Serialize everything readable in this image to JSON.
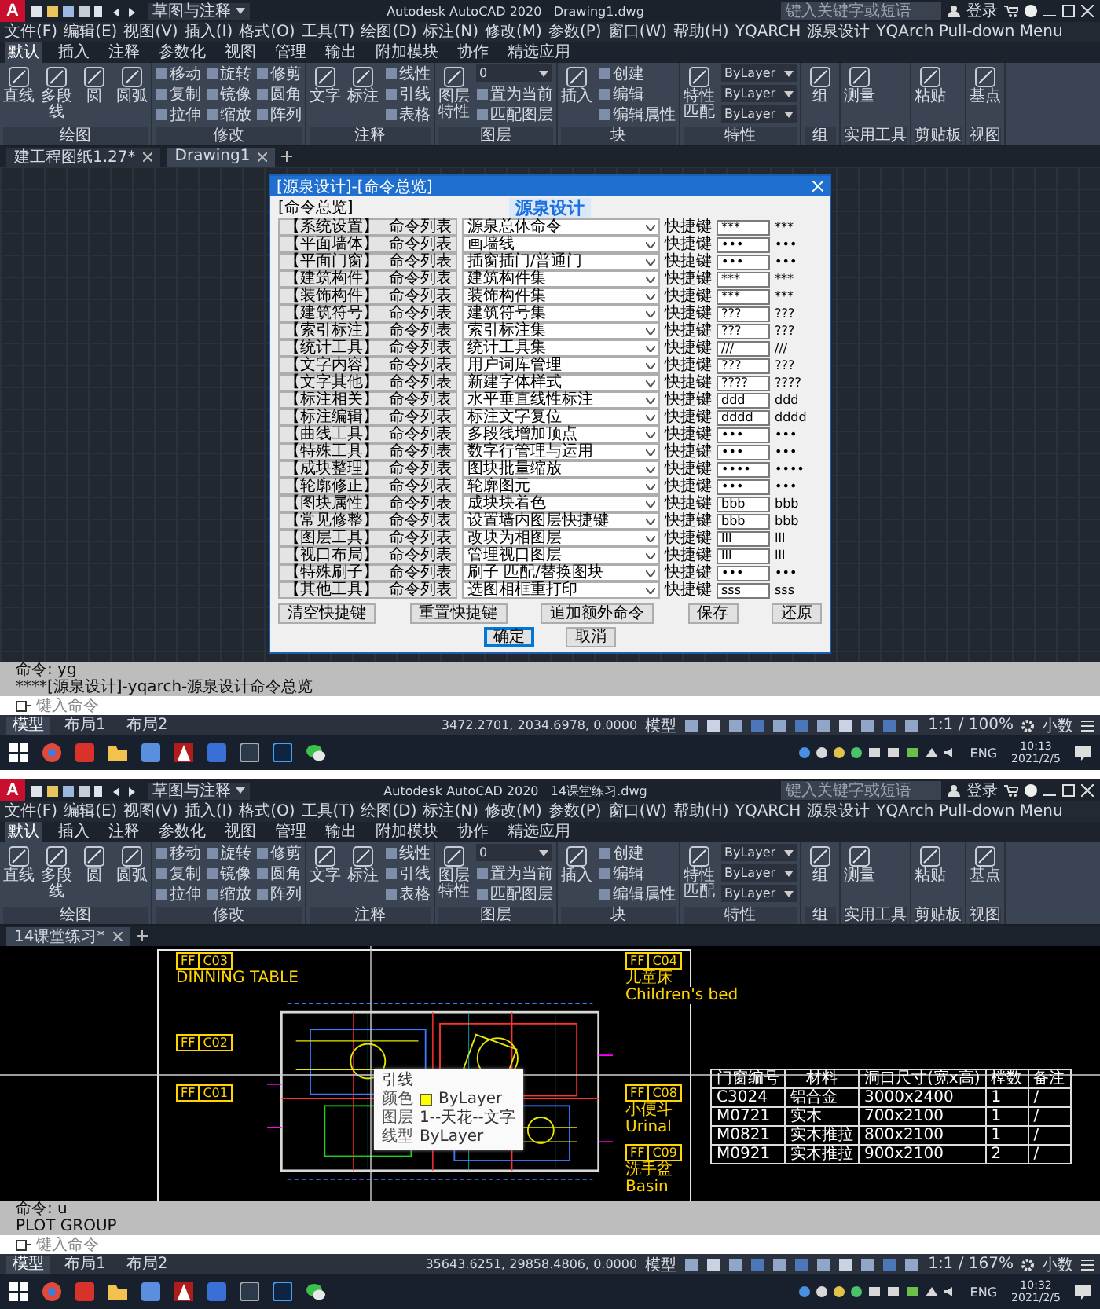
{
  "windows": [
    {
      "kind": "dialog",
      "app_logo": "A",
      "workspace": "草图与注释",
      "app_title": "Autodesk AutoCAD 2020",
      "file_title": "Drawing1.dwg",
      "search_placeholder": "键入关键字或短语",
      "user": "登录",
      "menu": [
        "文件(F)",
        "编辑(E)",
        "视图(V)",
        "插入(I)",
        "格式(O)",
        "工具(T)",
        "绘图(D)",
        "标注(N)",
        "修改(M)",
        "参数(P)",
        "窗口(W)",
        "帮助(H)",
        "YQARCH",
        "源泉设计",
        "YQArch Pull-down Menu"
      ],
      "ribbon_tabs": [
        {
          "label": "默认",
          "selected": true
        },
        {
          "label": "插入",
          "selected": false
        },
        {
          "label": "注释",
          "selected": false
        },
        {
          "label": "参数化",
          "selected": false
        },
        {
          "label": "视图",
          "selected": false
        },
        {
          "label": "管理",
          "selected": false
        },
        {
          "label": "输出",
          "selected": false
        },
        {
          "label": "附加模块",
          "selected": false
        },
        {
          "label": "协作",
          "selected": false
        },
        {
          "label": "精选应用",
          "selected": false
        }
      ],
      "ribbon": [
        {
          "title": "绘图",
          "items": [
            {
              "kind": "big",
              "label": "直线"
            },
            {
              "kind": "big",
              "label": "多段线"
            },
            {
              "kind": "big",
              "label": "圆"
            },
            {
              "kind": "big",
              "label": "圆弧"
            }
          ]
        },
        {
          "title": "修改",
          "items": [
            {
              "kind": "small",
              "label": "移动"
            },
            {
              "kind": "small",
              "label": "复制"
            },
            {
              "kind": "small",
              "label": "拉伸"
            },
            {
              "kind": "small",
              "label": "旋转"
            },
            {
              "kind": "small",
              "label": "镜像"
            },
            {
              "kind": "small",
              "label": "缩放"
            },
            {
              "kind": "small",
              "label": "修剪"
            },
            {
              "kind": "small",
              "label": "圆角"
            },
            {
              "kind": "small",
              "label": "阵列"
            }
          ]
        },
        {
          "title": "注释",
          "items": [
            {
              "kind": "big",
              "label": "文字"
            },
            {
              "kind": "big",
              "label": "标注"
            },
            {
              "kind": "small",
              "label": "线性"
            },
            {
              "kind": "small",
              "label": "引线"
            },
            {
              "kind": "small",
              "label": "表格"
            }
          ]
        },
        {
          "title": "图层",
          "items": [
            {
              "kind": "big",
              "label": "图层特性"
            },
            {
              "kind": "select",
              "label": "0"
            },
            {
              "kind": "small",
              "label": "置为当前"
            },
            {
              "kind": "small",
              "label": "匹配图层"
            }
          ]
        },
        {
          "title": "块",
          "items": [
            {
              "kind": "big",
              "label": "插入"
            },
            {
              "kind": "small",
              "label": "创建"
            },
            {
              "kind": "small",
              "label": "编辑"
            },
            {
              "kind": "small",
              "label": "编辑属性"
            }
          ]
        },
        {
          "title": "特性",
          "items": [
            {
              "kind": "big",
              "label": "特性匹配"
            },
            {
              "kind": "select",
              "label": "ByLayer"
            },
            {
              "kind": "select",
              "label": "ByLayer"
            },
            {
              "kind": "select",
              "label": "ByLayer"
            }
          ]
        },
        {
          "title": "组",
          "items": [
            {
              "kind": "big",
              "label": "组"
            }
          ]
        },
        {
          "title": "实用工具",
          "items": [
            {
              "kind": "big",
              "label": "测量"
            }
          ]
        },
        {
          "title": "剪贴板",
          "items": [
            {
              "kind": "big",
              "label": "粘贴"
            }
          ]
        },
        {
          "title": "视图",
          "items": [
            {
              "kind": "big",
              "label": "基点"
            }
          ]
        }
      ],
      "doc_tabs": [
        {
          "label": "建工程图纸1.27*",
          "selected": false
        },
        {
          "label": "Drawing1",
          "selected": true
        }
      ],
      "dialog": {
        "title": "[源泉设计]-[命令总览]",
        "logo": "源泉设计",
        "group": "[命令总览]",
        "rows": [
          {
            "category": "【系统设置】",
            "list": "命令列表",
            "command": "源泉总体命令",
            "shortcut_label": "快捷键",
            "shortcut": "***",
            "preview": "***"
          },
          {
            "category": "【平面墙体】",
            "list": "命令列表",
            "command": "画墙线",
            "shortcut_label": "快捷键",
            "shortcut": "•••",
            "preview": "•••"
          },
          {
            "category": "【平面门窗】",
            "list": "命令列表",
            "command": "插窗插门/普通门",
            "shortcut_label": "快捷键",
            "shortcut": "•••",
            "preview": "•••"
          },
          {
            "category": "【建筑构件】",
            "list": "命令列表",
            "command": "建筑构件集",
            "shortcut_label": "快捷键",
            "shortcut": "***",
            "preview": "***"
          },
          {
            "category": "【装饰构件】",
            "list": "命令列表",
            "command": "装饰构件集",
            "shortcut_label": "快捷键",
            "shortcut": "***",
            "preview": "***"
          },
          {
            "category": "【建筑符号】",
            "list": "命令列表",
            "command": "建筑符号集",
            "shortcut_label": "快捷键",
            "shortcut": "???",
            "preview": "???"
          },
          {
            "category": "【索引标注】",
            "list": "命令列表",
            "command": "索引标注集",
            "shortcut_label": "快捷键",
            "shortcut": "???",
            "preview": "???"
          },
          {
            "category": "【统计工具】",
            "list": "命令列表",
            "command": "统计工具集",
            "shortcut_label": "快捷键",
            "shortcut": "///",
            "preview": "///"
          },
          {
            "category": "【文字内容】",
            "list": "命令列表",
            "command": "用户词库管理",
            "shortcut_label": "快捷键",
            "shortcut": "???",
            "preview": "???"
          },
          {
            "category": "【文字其他】",
            "list": "命令列表",
            "command": "新建字体样式",
            "shortcut_label": "快捷键",
            "shortcut": "????",
            "preview": "????"
          },
          {
            "category": "【标注相关】",
            "list": "命令列表",
            "command": "水平垂直线性标注",
            "shortcut_label": "快捷键",
            "shortcut": "ddd",
            "preview": "ddd"
          },
          {
            "category": "【标注编辑】",
            "list": "命令列表",
            "command": "标注文字复位",
            "shortcut_label": "快捷键",
            "shortcut": "dddd",
            "preview": "dddd"
          },
          {
            "category": "【曲线工具】",
            "list": "命令列表",
            "command": "多段线增加顶点",
            "shortcut_label": "快捷键",
            "shortcut": "•••",
            "preview": "•••"
          },
          {
            "category": "【特殊工具】",
            "list": "命令列表",
            "command": "数字行管理与运用",
            "shortcut_label": "快捷键",
            "shortcut": "•••",
            "preview": "•••"
          },
          {
            "category": "【成块整理】",
            "list": "命令列表",
            "command": "图块批量缩放",
            "shortcut_label": "快捷键",
            "shortcut": "••••",
            "preview": "••••"
          },
          {
            "category": "【轮廓修正】",
            "list": "命令列表",
            "command": "轮廓图元",
            "shortcut_label": "快捷键",
            "shortcut": "•••",
            "preview": "•••"
          },
          {
            "category": "【图块属性】",
            "list": "命令列表",
            "command": "成块块着色",
            "shortcut_label": "快捷键",
            "shortcut": "bbb",
            "preview": "bbb"
          },
          {
            "category": "【常见修整】",
            "list": "命令列表",
            "command": "设置墙内图层快捷键",
            "shortcut_label": "快捷键",
            "shortcut": "bbb",
            "preview": "bbb"
          },
          {
            "category": "【图层工具】",
            "list": "命令列表",
            "command": "改块为相图层",
            "shortcut_label": "快捷键",
            "shortcut": "lll",
            "preview": "lll"
          },
          {
            "category": "【视口布局】",
            "list": "命令列表",
            "command": "管理视口图层",
            "shortcut_label": "快捷键",
            "shortcut": "lll",
            "preview": "lll"
          },
          {
            "category": "【特殊刷子】",
            "list": "命令列表",
            "command": "刷子 匹配/替换图块",
            "shortcut_label": "快捷键",
            "shortcut": "•••",
            "preview": "•••"
          },
          {
            "category": "【其他工具】",
            "list": "命令列表",
            "command": "选图相框重打印",
            "shortcut_label": "快捷键",
            "shortcut": "sss",
            "preview": "sss"
          }
        ],
        "actions": [
          "清空快捷键",
          "重置快捷键",
          "追加额外命令",
          "保存",
          "还原"
        ],
        "footer": [
          {
            "label": "确定",
            "selected": true
          },
          {
            "label": "取消",
            "selected": false
          }
        ]
      },
      "command_history": [
        "命令: yg",
        "****[源泉设计]-yqarch-源泉设计命令总览"
      ],
      "command_placeholder": "键入命令",
      "layout_tabs": [
        {
          "label": "模型",
          "selected": true
        },
        {
          "label": "布局1",
          "selected": false
        },
        {
          "label": "布局2",
          "selected": false
        }
      ],
      "coordinates": "3472.2701, 2034.6978, 0.0000",
      "space": "模型",
      "scale": "1:1 / 100%",
      "units": "小数",
      "lang": "ENG",
      "time": "10:13",
      "date": "2021/2/5"
    },
    {
      "kind": "drawing",
      "app_logo": "A",
      "workspace": "草图与注释",
      "app_title": "Autodesk AutoCAD 2020",
      "file_title": "14课堂练习.dwg",
      "search_placeholder": "键入关键字或短语",
      "user": "登录",
      "menu": [
        "文件(F)",
        "编辑(E)",
        "视图(V)",
        "插入(I)",
        "格式(O)",
        "工具(T)",
        "绘图(D)",
        "标注(N)",
        "修改(M)",
        "参数(P)",
        "窗口(W)",
        "帮助(H)",
        "YQARCH",
        "源泉设计",
        "YQArch Pull-down Menu"
      ],
      "ribbon_tabs": [
        {
          "label": "默认",
          "selected": true
        },
        {
          "label": "插入",
          "selected": false
        },
        {
          "label": "注释",
          "selected": false
        },
        {
          "label": "参数化",
          "selected": false
        },
        {
          "label": "视图",
          "selected": false
        },
        {
          "label": "管理",
          "selected": false
        },
        {
          "label": "输出",
          "selected": false
        },
        {
          "label": "附加模块",
          "selected": false
        },
        {
          "label": "协作",
          "selected": false
        },
        {
          "label": "精选应用",
          "selected": false
        }
      ],
      "ribbon": [
        {
          "title": "绘图",
          "items": [
            {
              "kind": "big",
              "label": "直线"
            },
            {
              "kind": "big",
              "label": "多段线"
            },
            {
              "kind": "big",
              "label": "圆"
            },
            {
              "kind": "big",
              "label": "圆弧"
            }
          ]
        },
        {
          "title": "修改",
          "items": [
            {
              "kind": "small",
              "label": "移动"
            },
            {
              "kind": "small",
              "label": "复制"
            },
            {
              "kind": "small",
              "label": "拉伸"
            },
            {
              "kind": "small",
              "label": "旋转"
            },
            {
              "kind": "small",
              "label": "镜像"
            },
            {
              "kind": "small",
              "label": "缩放"
            },
            {
              "kind": "small",
              "label": "修剪"
            },
            {
              "kind": "small",
              "label": "圆角"
            },
            {
              "kind": "small",
              "label": "阵列"
            }
          ]
        },
        {
          "title": "注释",
          "items": [
            {
              "kind": "big",
              "label": "文字"
            },
            {
              "kind": "big",
              "label": "标注"
            },
            {
              "kind": "small",
              "label": "线性"
            },
            {
              "kind": "small",
              "label": "引线"
            },
            {
              "kind": "small",
              "label": "表格"
            }
          ]
        },
        {
          "title": "图层",
          "items": [
            {
              "kind": "big",
              "label": "图层特性"
            },
            {
              "kind": "select",
              "label": "0"
            },
            {
              "kind": "small",
              "label": "置为当前"
            },
            {
              "kind": "small",
              "label": "匹配图层"
            }
          ]
        },
        {
          "title": "块",
          "items": [
            {
              "kind": "big",
              "label": "插入"
            },
            {
              "kind": "small",
              "label": "创建"
            },
            {
              "kind": "small",
              "label": "编辑"
            },
            {
              "kind": "small",
              "label": "编辑属性"
            }
          ]
        },
        {
          "title": "特性",
          "items": [
            {
              "kind": "big",
              "label": "特性匹配"
            },
            {
              "kind": "select",
              "label": "ByLayer"
            },
            {
              "kind": "select",
              "label": "ByLayer"
            },
            {
              "kind": "select",
              "label": "ByLayer"
            }
          ]
        },
        {
          "title": "组",
          "items": [
            {
              "kind": "big",
              "label": "组"
            }
          ]
        },
        {
          "title": "实用工具",
          "items": [
            {
              "kind": "big",
              "label": "测量"
            }
          ]
        },
        {
          "title": "剪贴板",
          "items": [
            {
              "kind": "big",
              "label": "粘贴"
            }
          ]
        },
        {
          "title": "视图",
          "items": [
            {
              "kind": "big",
              "label": "基点"
            }
          ]
        }
      ],
      "doc_tabs": [
        {
          "label": "14课堂练习*",
          "selected": true
        }
      ],
      "drawing": {
        "callouts": [
          {
            "code": "FF",
            "number": "C03",
            "lines": [
              "DINNING TABLE"
            ]
          },
          {
            "code": "FF",
            "number": "C02"
          },
          {
            "code": "FF",
            "number": "C01"
          },
          {
            "code": "FF",
            "number": "C04",
            "lines": [
              "儿童床",
              "Children's bed"
            ]
          },
          {
            "code": "FF",
            "number": "C08",
            "lines": [
              "小便斗",
              "Urinal"
            ]
          },
          {
            "code": "FF",
            "number": "C09",
            "lines": [
              "洗手盆",
              "Basin"
            ]
          }
        ],
        "tooltip": {
          "title": "引线",
          "rows": [
            {
              "label": "颜色",
              "value": "ByLayer",
              "color": "#ffff00"
            },
            {
              "label": "图层",
              "value": "1--天花--文字"
            },
            {
              "label": "线型",
              "value": "ByLayer"
            }
          ]
        },
        "table": {
          "columns": [
            "门窗编号",
            "材料",
            "洞口尺寸(宽x高)",
            "樘数",
            "备注"
          ],
          "rows": [
            [
              "C3024",
              "铝合金",
              "3000x2400",
              "1",
              "/"
            ],
            [
              "M0721",
              "实木",
              "700x2100",
              "1",
              "/"
            ],
            [
              "M0821",
              "实木推拉",
              "800x2100",
              "1",
              "/"
            ],
            [
              "M0921",
              "实木推拉",
              "900x2100",
              "2",
              "/"
            ]
          ]
        }
      },
      "command_history": [
        "命令: u",
        "PLOT GROUP"
      ],
      "command_placeholder": "键入命令",
      "layout_tabs": [
        {
          "label": "模型",
          "selected": true
        },
        {
          "label": "布局1",
          "selected": false
        },
        {
          "label": "布局2",
          "selected": false
        }
      ],
      "coordinates": "35643.6251, 29858.4806, 0.0000",
      "space": "模型",
      "scale": "1:1 / 167%",
      "units": "小数",
      "lang": "ENG",
      "time": "10:32",
      "date": "2021/2/5"
    }
  ]
}
